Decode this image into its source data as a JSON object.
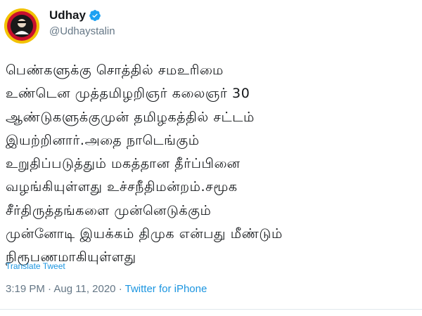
{
  "author": {
    "display_name": "Udhay",
    "handle": "@Udhaystalin",
    "verified": true,
    "avatar_icon": "profile-avatar-icon"
  },
  "tweet": {
    "lines": [
      "பெண்களுக்கு சொத்தில் சமஉரிமை",
      "உண்டென முத்தமிழறிஞர் கலைஞர் 30",
      "ஆண்டுகளுக்குமுன் தமிழகத்தில் சட்டம்",
      "இயற்றினார்.அதை நாடெங்கும்",
      "உறுதிப்படுத்தும் மகத்தான தீர்ப்பினை",
      "வழங்கியுள்ளது உச்சநீதிமன்றம்.சமூக",
      "சீர்திருத்தங்களை முன்னெடுக்கும்",
      "முன்னோடி இயக்கம் திமுக என்பது மீண்டும்",
      "நிரூபணமாகியுள்ளது"
    ],
    "translate_label": "Translate Tweet",
    "time": "3:19 PM",
    "separator": "·",
    "date": "Aug 11, 2020",
    "source": "Twitter for iPhone"
  },
  "colors": {
    "link": "#1b95e0",
    "secondary": "#657786",
    "verified": "#1da1f2"
  }
}
